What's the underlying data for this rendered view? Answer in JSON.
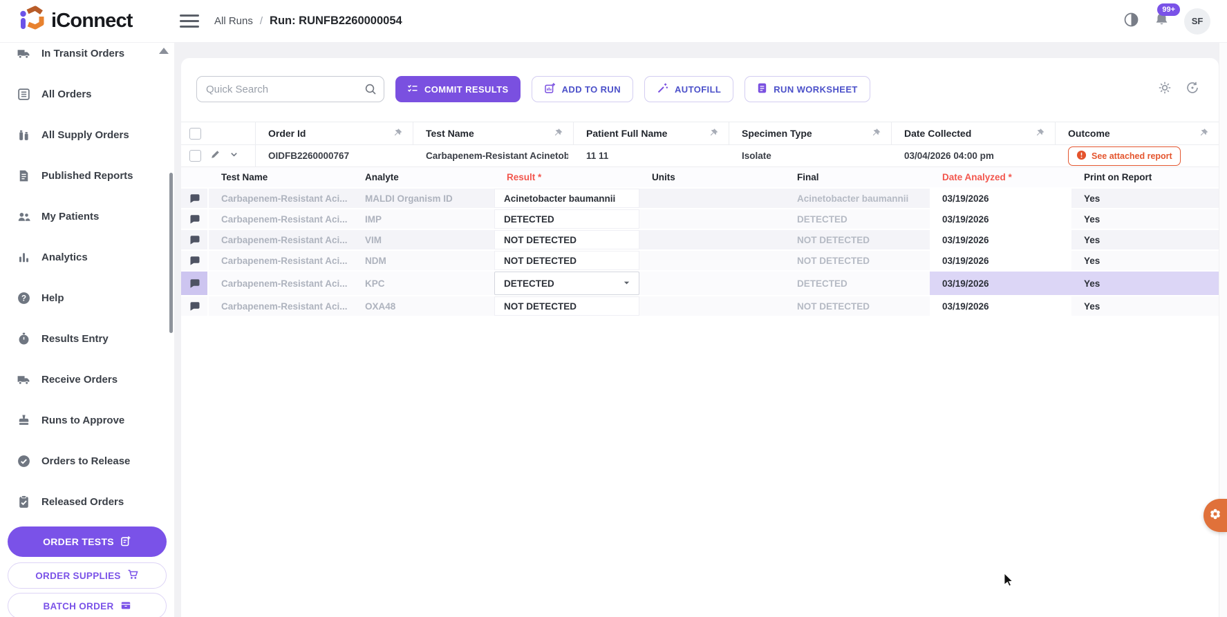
{
  "header": {
    "app_name": "iConnect",
    "breadcrumb": {
      "parent": "All Runs",
      "separator": "/",
      "current": "Run: RUNFB2260000054"
    },
    "notification_count": "99+",
    "user_initials": "SF"
  },
  "sidebar": {
    "items": [
      {
        "label": "In Transit Orders",
        "icon": "truck-icon"
      },
      {
        "label": "All Orders",
        "icon": "list-icon"
      },
      {
        "label": "All Supply Orders",
        "icon": "supply-bottles-icon"
      },
      {
        "label": "Published Reports",
        "icon": "document-icon"
      },
      {
        "label": "My Patients",
        "icon": "patients-icon"
      },
      {
        "label": "Analytics",
        "icon": "bar-chart-icon"
      },
      {
        "label": "Help",
        "icon": "question-circle-icon"
      },
      {
        "label": "Results Entry",
        "icon": "stopwatch-icon"
      },
      {
        "label": "Receive Orders",
        "icon": "truck-icon"
      },
      {
        "label": "Runs to Approve",
        "icon": "stamp-icon"
      },
      {
        "label": "Orders to Release",
        "icon": "release-circle-icon"
      },
      {
        "label": "Released Orders",
        "icon": "clipboard-check-icon"
      }
    ],
    "actions": [
      {
        "label": "ORDER TESTS"
      },
      {
        "label": "ORDER SUPPLIES"
      },
      {
        "label": "BATCH ORDER"
      }
    ]
  },
  "toolbar": {
    "search_placeholder": "Quick Search",
    "commit_results": "COMMIT RESULTS",
    "add_to_run": "ADD TO RUN",
    "autofill": "AUTOFILL",
    "run_worksheet": "RUN WORKSHEET"
  },
  "orders_table": {
    "columns": [
      "Order Id",
      "Test Name",
      "Patient Full Name",
      "Specimen Type",
      "Date Collected",
      "Outcome"
    ],
    "row": {
      "order_id": "OIDFB2260000767",
      "test_name": "Carbapenem-Resistant Acinetobacte",
      "patient_full_name": "11 11",
      "specimen_type": "Isolate",
      "date_collected": "03/04/2026 04:00 pm",
      "outcome_badge": "See attached report"
    }
  },
  "results_table": {
    "columns": [
      "Test Name",
      "Analyte",
      "Result *",
      "Units",
      "Final",
      "Date Analyzed *",
      "Print on Report"
    ],
    "rows": [
      {
        "test_name": "Carbapenem-Resistant Aci...",
        "analyte": "MALDI Organism ID",
        "result": "Acinetobacter baumannii",
        "units": "",
        "final": "Acinetobacter baumannii",
        "date_analyzed": "03/19/2026",
        "print_on_report": "Yes",
        "selected": false
      },
      {
        "test_name": "Carbapenem-Resistant Aci...",
        "analyte": "IMP",
        "result": "DETECTED",
        "units": "",
        "final": "DETECTED",
        "date_analyzed": "03/19/2026",
        "print_on_report": "Yes",
        "selected": false
      },
      {
        "test_name": "Carbapenem-Resistant Aci...",
        "analyte": "VIM",
        "result": "NOT DETECTED",
        "units": "",
        "final": "NOT DETECTED",
        "date_analyzed": "03/19/2026",
        "print_on_report": "Yes",
        "selected": false
      },
      {
        "test_name": "Carbapenem-Resistant Aci...",
        "analyte": "NDM",
        "result": "NOT DETECTED",
        "units": "",
        "final": "NOT DETECTED",
        "date_analyzed": "03/19/2026",
        "print_on_report": "Yes",
        "selected": false
      },
      {
        "test_name": "Carbapenem-Resistant Aci...",
        "analyte": "KPC",
        "result": "DETECTED",
        "units": "",
        "final": "DETECTED",
        "date_analyzed": "03/19/2026",
        "print_on_report": "Yes",
        "selected": true
      },
      {
        "test_name": "Carbapenem-Resistant Aci...",
        "analyte": "OXA48",
        "result": "NOT DETECTED",
        "units": "",
        "final": "NOT DETECTED",
        "date_analyzed": "03/19/2026",
        "print_on_report": "Yes",
        "selected": false
      }
    ]
  },
  "colors": {
    "accent_purple": "#7a50e0",
    "outline_button_text": "#4b50c9",
    "required_red": "#f2564d",
    "outcome_orange": "#e4562f",
    "selection_lavender": "#dcd6f6",
    "fab_orange": "#e0713a"
  }
}
